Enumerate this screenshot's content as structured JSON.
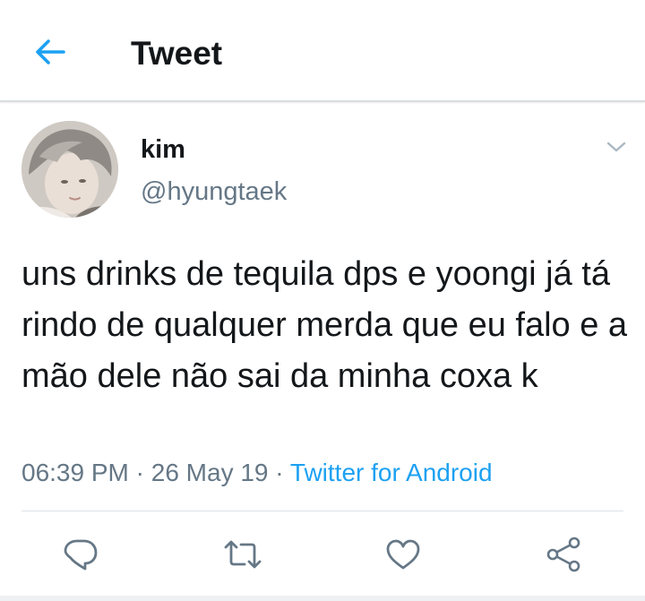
{
  "header": {
    "title": "Tweet",
    "back_icon": "arrow-left-icon"
  },
  "tweet": {
    "author": {
      "display_name": "kim",
      "handle": "@hyungtaek"
    },
    "menu_icon": "chevron-down-icon",
    "text": "uns drinks de tequila dps e yoongi já tá rindo de qualquer merda que eu falo e a mão dele não sai da minha coxa k",
    "time": "06:39 PM",
    "date": "26 May 19",
    "separator": "·",
    "source": "Twitter for Android"
  },
  "actions": [
    {
      "name": "reply",
      "icon": "reply-icon"
    },
    {
      "name": "retweet",
      "icon": "retweet-icon"
    },
    {
      "name": "like",
      "icon": "heart-icon"
    },
    {
      "name": "share",
      "icon": "share-icon"
    }
  ],
  "colors": {
    "accent": "#1da1f2",
    "text": "#14171a",
    "secondary": "#657786",
    "icon": "#657786"
  }
}
